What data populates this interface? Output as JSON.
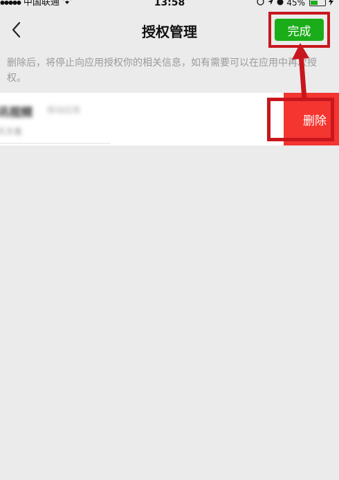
{
  "status_bar": {
    "carrier": "中国联通",
    "time": "13:58",
    "battery": "45%"
  },
  "nav": {
    "title": "授权管理",
    "done_label": "完成"
  },
  "notice": {
    "text": "删除后，将停止向应用授权你的相关信息，如有需要可以在应用中再次授权。"
  },
  "app_row": {
    "name": "讯视频",
    "tag": "移动应用",
    "subtitle": "天天看",
    "delete_label": "删除"
  },
  "colors": {
    "primary_green": "#1aad19",
    "delete_red": "#f43530",
    "annotation_red": "#c8161d",
    "background": "#ebebeb"
  },
  "icons": [
    "signal-icon",
    "wifi-icon",
    "location-icon",
    "alarm-icon",
    "battery-icon",
    "charging-icon",
    "back-icon"
  ]
}
